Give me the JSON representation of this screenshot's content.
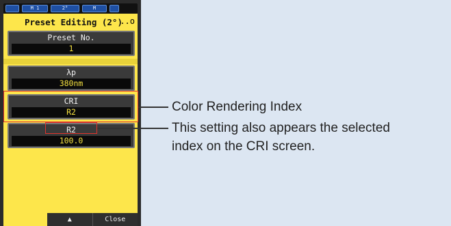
{
  "status_bar": {
    "segments": [
      "M 1",
      "2°",
      "M"
    ]
  },
  "screen": {
    "title": "Preset Editing (2°)",
    "title_dots": "..o",
    "fields": [
      {
        "label": "Preset No.",
        "value": "1"
      },
      {
        "label": "λp",
        "value": "380nm"
      },
      {
        "label": "CRI",
        "value": "R2"
      },
      {
        "label": "R2",
        "value": "100.0"
      }
    ],
    "footer": {
      "up_label": "▲",
      "close_label": "Close"
    }
  },
  "annotations": {
    "cri_callout": "Color Rendering Index",
    "r2_callout_line1": "This setting also appears the selected",
    "r2_callout_line2": "index on the CRI screen."
  },
  "colors": {
    "screen_bg": "#fde64b",
    "highlight": "#e0342c",
    "value_text": "#f4e040"
  }
}
